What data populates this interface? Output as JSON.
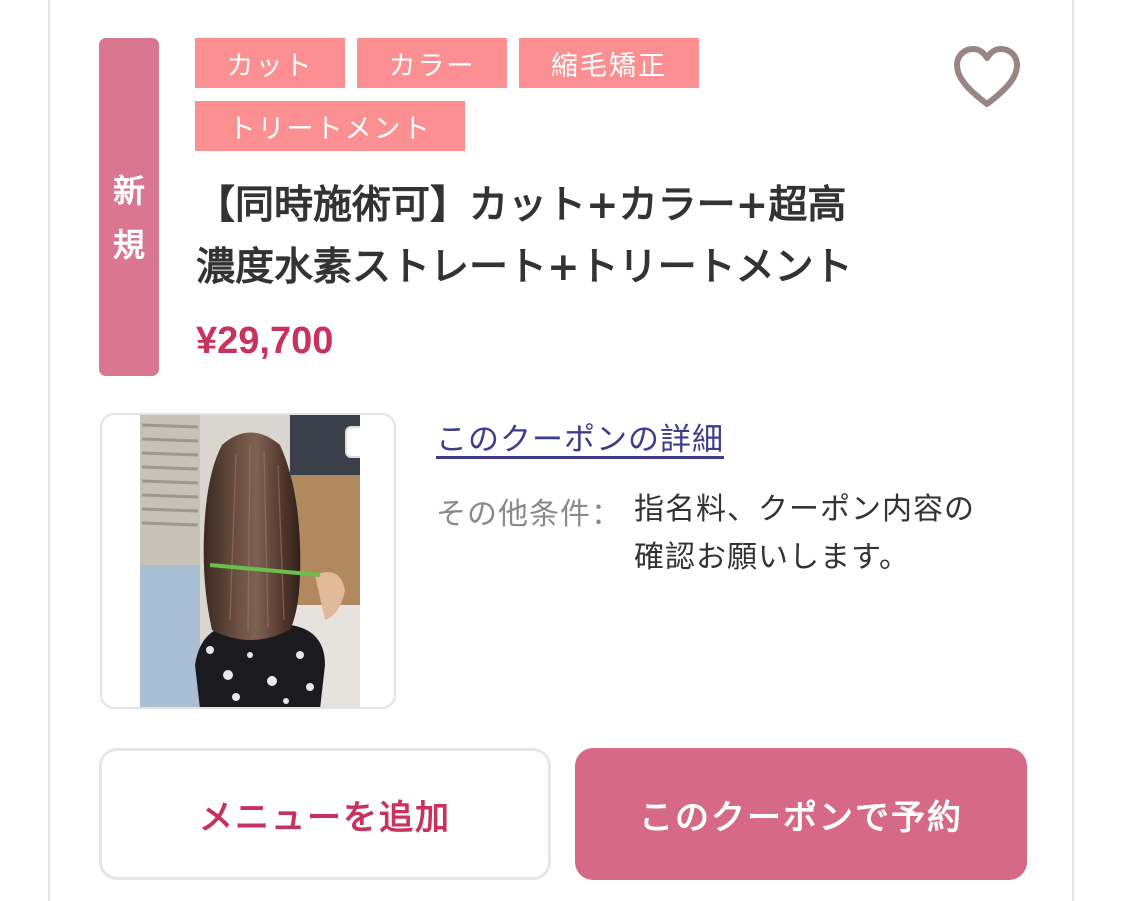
{
  "badge": {
    "line1": "新",
    "line2": "規"
  },
  "tags": [
    "カット",
    "カラー",
    "縮毛矯正",
    "トリートメント"
  ],
  "coupon": {
    "title_line1": "【同時施術可】カット+カラー+超高",
    "title_line2": "濃度水素ストレート+トリートメント",
    "price": "¥29,700"
  },
  "details": {
    "link_label": "このクーポンの詳細",
    "condition_label": "その他条件：",
    "condition_line1": "指名料、クーポン内容の",
    "condition_line2": "確認お願いします。"
  },
  "buttons": {
    "add_menu": "メニューを追加",
    "reserve": "このクーポンで予約"
  },
  "colors": {
    "badge": "#d8778f",
    "tag": "#fb8f91",
    "price": "#c8325e",
    "link": "#3e3d8a",
    "reserve_button": "#d66a86"
  },
  "icons": {
    "favorite": "heart-outline-icon"
  }
}
